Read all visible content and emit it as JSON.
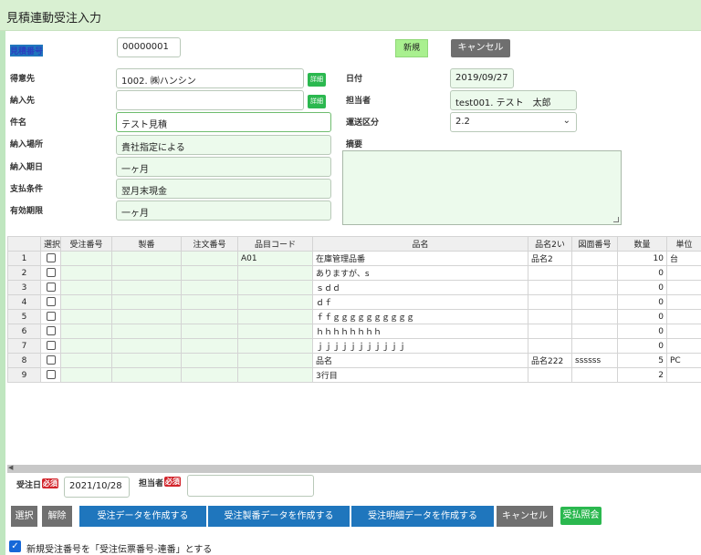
{
  "title": "見積連動受注入力",
  "header": {
    "quote_no_label": "見積番号",
    "quote_no": "00000001",
    "new_label": "新規",
    "cancel_label": "キャンセル"
  },
  "form": {
    "customer_label": "得意先",
    "customer": "1002. ㈱ハンシン",
    "ship_to_label": "納入先",
    "ship_to": "",
    "detail_label": "詳細",
    "subject_label": "件名",
    "subject": "テスト見積",
    "delivery_place_label": "納入場所",
    "delivery_place": "貴社指定による",
    "delivery_period_label": "納入期日",
    "delivery_period": "一ヶ月",
    "payment_label": "支払条件",
    "payment": "翌月末現金",
    "validity_label": "有効期限",
    "validity": "一ヶ月",
    "date_label": "日付",
    "date": "2019/09/27",
    "staff_label": "担当者",
    "staff": "test001. テスト　太郎",
    "shipping_label": "運送区分",
    "shipping": "2.2",
    "memo_label": "摘要",
    "memo": ""
  },
  "table": {
    "headers": [
      "",
      "選択",
      "受注番号",
      "製番",
      "注文番号",
      "品目コード",
      "品名",
      "品名2い",
      "図面番号",
      "数量",
      "単位"
    ],
    "rows": [
      {
        "no": "1",
        "order_no": "",
        "seiban": "",
        "po_no": "",
        "item_code": "A01",
        "name": "在庫管理品番",
        "name2": "品名2",
        "drawing": "",
        "qty": "10",
        "unit": "台"
      },
      {
        "no": "2",
        "order_no": "",
        "seiban": "",
        "po_no": "",
        "item_code": "",
        "name": "ありますが、s",
        "name2": "",
        "drawing": "",
        "qty": "0",
        "unit": ""
      },
      {
        "no": "3",
        "order_no": "",
        "seiban": "",
        "po_no": "",
        "item_code": "",
        "name": "ｓｄｄ",
        "name2": "",
        "drawing": "",
        "qty": "0",
        "unit": ""
      },
      {
        "no": "4",
        "order_no": "",
        "seiban": "",
        "po_no": "",
        "item_code": "",
        "name": "ｄｆ",
        "name2": "",
        "drawing": "",
        "qty": "0",
        "unit": ""
      },
      {
        "no": "5",
        "order_no": "",
        "seiban": "",
        "po_no": "",
        "item_code": "",
        "name": "ｆｆｇｇｇｇｇｇｇｇｇｇ",
        "name2": "",
        "drawing": "",
        "qty": "0",
        "unit": ""
      },
      {
        "no": "6",
        "order_no": "",
        "seiban": "",
        "po_no": "",
        "item_code": "",
        "name": "ｈｈｈｈｈｈｈｈ",
        "name2": "",
        "drawing": "",
        "qty": "0",
        "unit": ""
      },
      {
        "no": "7",
        "order_no": "",
        "seiban": "",
        "po_no": "",
        "item_code": "",
        "name": "ｊｊｊｊｊｊｊｊｊｊｊ",
        "name2": "",
        "drawing": "",
        "qty": "0",
        "unit": ""
      },
      {
        "no": "8",
        "order_no": "",
        "seiban": "",
        "po_no": "",
        "item_code": "",
        "name": "品名",
        "name2": "品名222",
        "drawing": "ssssss",
        "qty": "5",
        "unit": "PC"
      },
      {
        "no": "9",
        "order_no": "",
        "seiban": "",
        "po_no": "",
        "item_code": "",
        "name": "3行目",
        "name2": "",
        "drawing": "",
        "qty": "2",
        "unit": ""
      }
    ]
  },
  "footer": {
    "order_date_label": "受注日",
    "required": "必須",
    "order_date": "2021/10/28",
    "staff_label": "担当者",
    "staff": "",
    "buttons": {
      "select": "選択",
      "release": "解除",
      "create_order": "受注データを作成する",
      "create_seiban": "受注製番データを作成する",
      "create_detail": "受注明細データを作成する",
      "cancel": "キャンセル",
      "payment_inquiry": "受払照会"
    },
    "checkbox_label": "新規受注番号を「受注伝票番号-連番」とする",
    "checkbox_checked": true
  }
}
